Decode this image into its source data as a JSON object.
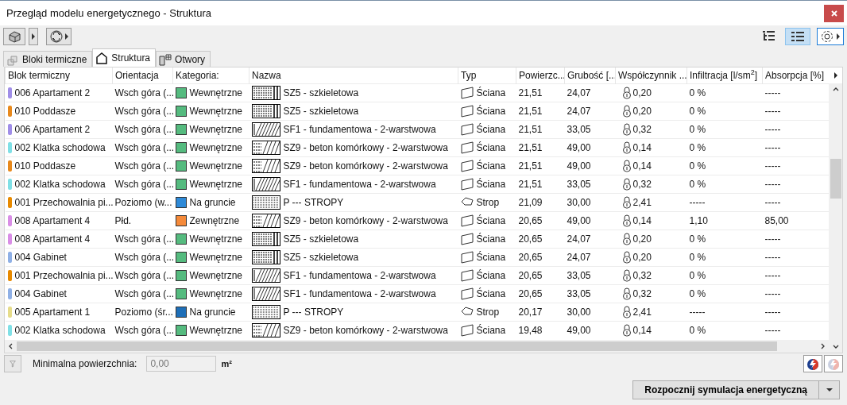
{
  "window": {
    "title": "Przegląd modelu energetycznego - Struktura"
  },
  "view_buttons": [
    {
      "kind": "tree",
      "selected": false
    },
    {
      "kind": "list",
      "selected": true
    }
  ],
  "tabs": [
    {
      "label": "Bloki termiczne",
      "kind": "blocks",
      "selected": false
    },
    {
      "label": "Struktura",
      "kind": "house",
      "selected": true
    },
    {
      "label": "Otwory",
      "kind": "door",
      "selected": false
    }
  ],
  "table": {
    "columns": [
      "Blok termiczny",
      "Orientacja",
      "Kategoria:",
      "Nazwa",
      "Typ",
      "Powierzc...",
      "Grubość [...",
      "Współczynnik ...",
      "Infiltracja [l/sm$^{2}$]",
      "Absorpcja [%]"
    ],
    "rows": [
      {
        "block": {
          "text": "006 Apartament 2",
          "color": "#a08ee8"
        },
        "orientation": "Wsch góra (...",
        "category": {
          "text": "Wewnętrzne",
          "color": "#55bb7f"
        },
        "name": {
          "text": "SZ5 - szkieletowa",
          "kind": "frame"
        },
        "type": {
          "text": "Ściana",
          "kind": "wall"
        },
        "area": "21,51",
        "thickness": "24,07",
        "coefficient": "0,20",
        "infiltration": "0 %",
        "absorption": "-----"
      },
      {
        "block": {
          "text": "010 Poddasze",
          "color": "#e8891c"
        },
        "orientation": "Wsch góra (...",
        "category": {
          "text": "Wewnętrzne",
          "color": "#55bb7f"
        },
        "name": {
          "text": "SZ5 - szkieletowa",
          "kind": "frame"
        },
        "type": {
          "text": "Ściana",
          "kind": "wall"
        },
        "area": "21,51",
        "thickness": "24,07",
        "coefficient": "0,20",
        "infiltration": "0 %",
        "absorption": "-----"
      },
      {
        "block": {
          "text": "006 Apartament 2",
          "color": "#a08ee8"
        },
        "orientation": "Wsch góra (...",
        "category": {
          "text": "Wewnętrzne",
          "color": "#55bb7f"
        },
        "name": {
          "text": "SF1 - fundamentowa - 2-warstwowa",
          "kind": "diagonal"
        },
        "type": {
          "text": "Ściana",
          "kind": "wall"
        },
        "area": "21,51",
        "thickness": "33,05",
        "coefficient": "0,32",
        "infiltration": "0 %",
        "absorption": "-----"
      },
      {
        "block": {
          "text": "002 Klatka schodowa",
          "color": "#80e0e6"
        },
        "orientation": "Wsch góra (...",
        "category": {
          "text": "Wewnętrzne",
          "color": "#55bb7f"
        },
        "name": {
          "text": "SZ9 - beton komórkowy - 2-warstwowa",
          "kind": "mixed"
        },
        "type": {
          "text": "Ściana",
          "kind": "wall"
        },
        "area": "21,51",
        "thickness": "49,00",
        "coefficient": "0,14",
        "infiltration": "0 %",
        "absorption": "-----"
      },
      {
        "block": {
          "text": "010 Poddasze",
          "color": "#e8891c"
        },
        "orientation": "Wsch góra (...",
        "category": {
          "text": "Wewnętrzne",
          "color": "#55bb7f"
        },
        "name": {
          "text": "SZ9 - beton komórkowy - 2-warstwowa",
          "kind": "mixed"
        },
        "type": {
          "text": "Ściana",
          "kind": "wall"
        },
        "area": "21,51",
        "thickness": "49,00",
        "coefficient": "0,14",
        "infiltration": "0 %",
        "absorption": "-----"
      },
      {
        "block": {
          "text": "002 Klatka schodowa",
          "color": "#80e0e6"
        },
        "orientation": "Wsch góra (...",
        "category": {
          "text": "Wewnętrzne",
          "color": "#55bb7f"
        },
        "name": {
          "text": "SF1 - fundamentowa - 2-warstwowa",
          "kind": "diagonal"
        },
        "type": {
          "text": "Ściana",
          "kind": "wall"
        },
        "area": "21,51",
        "thickness": "33,05",
        "coefficient": "0,32",
        "infiltration": "0 %",
        "absorption": "-----"
      },
      {
        "block": {
          "text": "001 Przechowalnia pi...",
          "color": "#e88a00"
        },
        "orientation": "Poziomo (w...",
        "category": {
          "text": "Na gruncie",
          "color": "#2e8ad8"
        },
        "name": {
          "text": "P --- STROPY",
          "kind": "dotted"
        },
        "type": {
          "text": "Strop",
          "kind": "slab"
        },
        "area": "21,09",
        "thickness": "30,00",
        "coefficient": "2,41",
        "infiltration": "-----",
        "absorption": "-----"
      },
      {
        "block": {
          "text": "008 Apartament 4",
          "color": "#d98ee6"
        },
        "orientation": "Płd.",
        "category": {
          "text": "Zewnętrzne",
          "color": "#f58a3a"
        },
        "name": {
          "text": "SZ9 - beton komórkowy - 2-warstwowa",
          "kind": "mixed"
        },
        "type": {
          "text": "Ściana",
          "kind": "wall"
        },
        "area": "20,65",
        "thickness": "49,00",
        "coefficient": "0,14",
        "infiltration": "1,10",
        "absorption": "85,00"
      },
      {
        "block": {
          "text": "008 Apartament 4",
          "color": "#d98ee6"
        },
        "orientation": "Wsch góra (...",
        "category": {
          "text": "Wewnętrzne",
          "color": "#55bb7f"
        },
        "name": {
          "text": "SZ5 - szkieletowa",
          "kind": "frame"
        },
        "type": {
          "text": "Ściana",
          "kind": "wall"
        },
        "area": "20,65",
        "thickness": "24,07",
        "coefficient": "0,20",
        "infiltration": "0 %",
        "absorption": "-----"
      },
      {
        "block": {
          "text": "004 Gabinet",
          "color": "#8fb0e6"
        },
        "orientation": "Wsch góra (...",
        "category": {
          "text": "Wewnętrzne",
          "color": "#55bb7f"
        },
        "name": {
          "text": "SZ5 - szkieletowa",
          "kind": "frame"
        },
        "type": {
          "text": "Ściana",
          "kind": "wall"
        },
        "area": "20,65",
        "thickness": "24,07",
        "coefficient": "0,20",
        "infiltration": "0 %",
        "absorption": "-----"
      },
      {
        "block": {
          "text": "001 Przechowalnia pi...",
          "color": "#e88a00"
        },
        "orientation": "Wsch góra (...",
        "category": {
          "text": "Wewnętrzne",
          "color": "#55bb7f"
        },
        "name": {
          "text": "SF1 - fundamentowa - 2-warstwowa",
          "kind": "diagonal"
        },
        "type": {
          "text": "Ściana",
          "kind": "wall"
        },
        "area": "20,65",
        "thickness": "33,05",
        "coefficient": "0,32",
        "infiltration": "0 %",
        "absorption": "-----"
      },
      {
        "block": {
          "text": "004 Gabinet",
          "color": "#8fb0e6"
        },
        "orientation": "Wsch góra (...",
        "category": {
          "text": "Wewnętrzne",
          "color": "#55bb7f"
        },
        "name": {
          "text": "SF1 - fundamentowa - 2-warstwowa",
          "kind": "diagonal"
        },
        "type": {
          "text": "Ściana",
          "kind": "wall"
        },
        "area": "20,65",
        "thickness": "33,05",
        "coefficient": "0,32",
        "infiltration": "0 %",
        "absorption": "-----"
      },
      {
        "block": {
          "text": "005 Apartament 1",
          "color": "#e6dc8a"
        },
        "orientation": "Poziomo (śr...",
        "category": {
          "text": "Na gruncie",
          "color": "#1e6fb8"
        },
        "name": {
          "text": "P --- STROPY",
          "kind": "dotted"
        },
        "type": {
          "text": "Strop",
          "kind": "slab"
        },
        "area": "20,17",
        "thickness": "30,00",
        "coefficient": "2,41",
        "infiltration": "-----",
        "absorption": "-----"
      },
      {
        "block": {
          "text": "002 Klatka schodowa",
          "color": "#80e0e6"
        },
        "orientation": "Wsch góra (...",
        "category": {
          "text": "Wewnętrzne",
          "color": "#55bb7f"
        },
        "name": {
          "text": "SZ9 - beton komórkowy - 2-warstwowa",
          "kind": "mixed"
        },
        "type": {
          "text": "Ściana",
          "kind": "wall"
        },
        "area": "19,48",
        "thickness": "49,00",
        "coefficient": "0,14",
        "infiltration": "0 %",
        "absorption": "-----"
      }
    ]
  },
  "filter": {
    "label": "Minimalna powierzchnia:",
    "value": "0,00",
    "disabled": true,
    "unit": "m²"
  },
  "footer": {
    "button": "Rozpocznij symulacja energetyczną"
  }
}
